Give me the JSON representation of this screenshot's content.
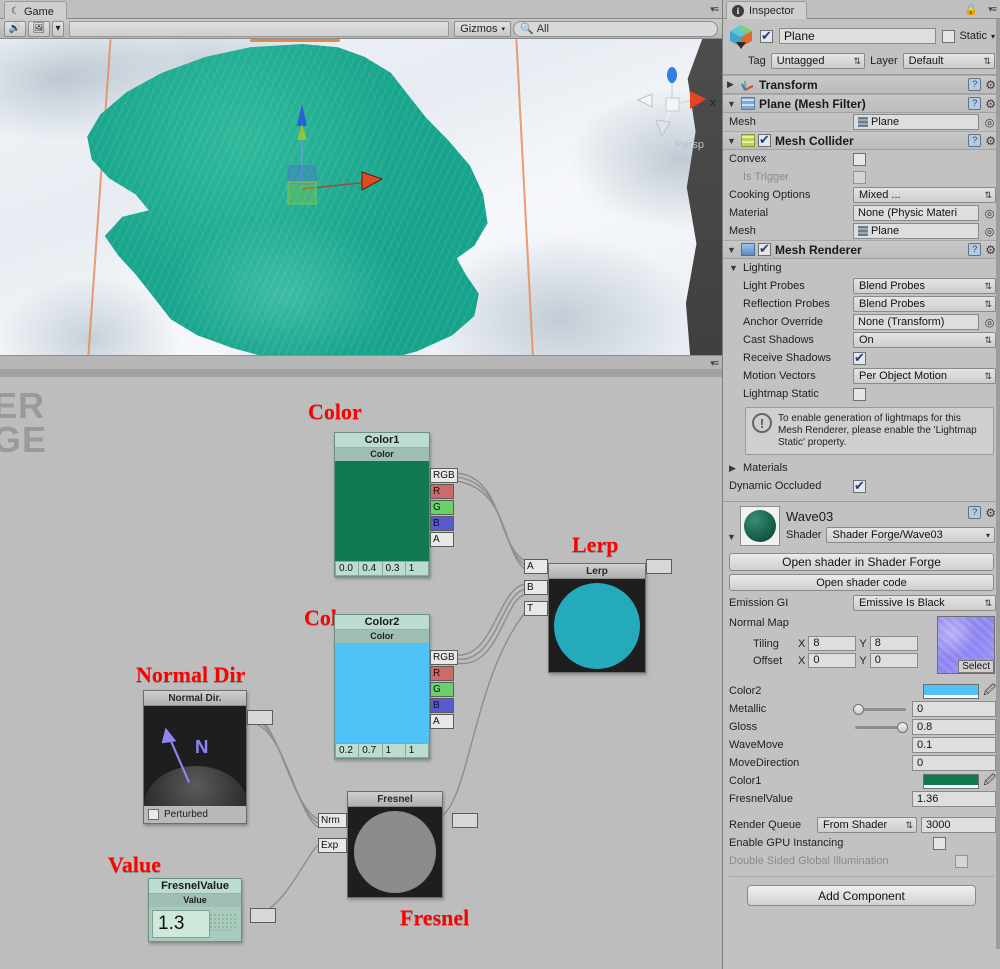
{
  "game_view": {
    "tab_label": "Game",
    "moon_icon": "moon-icon",
    "mute_icon": "mute-audio-icon",
    "stats_icon": "screenshot-icon",
    "gizmos_label": "Gizmos",
    "search_placeholder": "All",
    "search_value": "All",
    "persp_label": "Persp",
    "axis_x_label": "x",
    "watermark_line1": "DER",
    "watermark_line2": "RGE",
    "colors": {
      "water": "#16a88e",
      "terrain_light": "#eef2f7",
      "terrain_dark": "#454545",
      "grid_line": "#e88c5a"
    }
  },
  "graph": {
    "labels": {
      "color1": "Color",
      "color2": "Color",
      "lerp": "Lerp",
      "normal_dir": "Normal Dir",
      "value": "Value",
      "fresnel": "Fresnel"
    },
    "nodes": {
      "color1": {
        "name": "Color1",
        "type": "Color",
        "swatch": "#117a52",
        "channels": [
          "0.0",
          "0.4",
          "0.3",
          "1"
        ],
        "ports": [
          "RGB",
          "R",
          "G",
          "B",
          "A"
        ]
      },
      "color2": {
        "name": "Color2",
        "type": "Color",
        "swatch": "#4fc3f7",
        "channels": [
          "0.2",
          "0.7",
          "1",
          "1"
        ],
        "ports": [
          "RGB",
          "R",
          "G",
          "B",
          "A"
        ]
      },
      "lerp": {
        "title": "Lerp",
        "inputs": [
          "A",
          "B",
          "T"
        ],
        "preview_color": "#25aabb"
      },
      "normal_dir": {
        "title": "Normal Dir.",
        "checkbox_label": "Perturbed",
        "glyph": "N",
        "checked": false
      },
      "fresnel_value": {
        "name": "FresnelValue",
        "type": "Value",
        "value": "1.3"
      },
      "fresnel": {
        "title": "Fresnel",
        "inputs": [
          "Nrm",
          "Exp"
        ],
        "preview_color": "#8c8c8c"
      }
    }
  },
  "inspector": {
    "tab_label": "Inspector",
    "object": {
      "name": "Plane",
      "enabled": true,
      "static_label": "Static",
      "static_checked": false,
      "tag_label": "Tag",
      "tag_value": "Untagged",
      "layer_label": "Layer",
      "layer_value": "Default"
    },
    "components": [
      {
        "title": "Transform",
        "icon": "transform-axes-icon",
        "expanded": false
      },
      {
        "title": "Plane (Mesh Filter)",
        "icon": "mesh-filter-icon",
        "expanded": true,
        "rows": [
          {
            "label": "Mesh",
            "value": "Plane",
            "type": "object"
          }
        ]
      },
      {
        "title": "Mesh Collider",
        "icon": "mesh-collider-icon",
        "expanded": true,
        "enabled": true,
        "rows": [
          {
            "label": "Convex",
            "type": "checkbox",
            "checked": false
          },
          {
            "label": "Is Trigger",
            "type": "checkbox",
            "checked": false,
            "disabled": true
          },
          {
            "label": "Cooking Options",
            "type": "dropdown",
            "value": "Mixed ..."
          },
          {
            "label": "Material",
            "type": "object",
            "value": "None (Physic Materi"
          },
          {
            "label": "Mesh",
            "type": "object",
            "value": "Plane"
          }
        ]
      },
      {
        "title": "Mesh Renderer",
        "icon": "mesh-renderer-icon",
        "expanded": true,
        "enabled": true,
        "group": "Lighting",
        "rows": [
          {
            "label": "Light Probes",
            "type": "dropdown",
            "value": "Blend Probes"
          },
          {
            "label": "Reflection Probes",
            "type": "dropdown",
            "value": "Blend Probes"
          },
          {
            "label": "Anchor Override",
            "type": "object",
            "value": "None (Transform)"
          },
          {
            "label": "Cast Shadows",
            "type": "dropdown",
            "value": "On"
          },
          {
            "label": "Receive Shadows",
            "type": "checkbox",
            "checked": true
          },
          {
            "label": "Motion Vectors",
            "type": "dropdown",
            "value": "Per Object Motion"
          },
          {
            "label": "Lightmap Static",
            "type": "checkbox",
            "checked": false
          }
        ],
        "helpbox": "To enable generation of lightmaps for this Mesh Renderer, please enable the 'Lightmap Static' property.",
        "materials_label": "Materials",
        "dynamic_occluded_label": "Dynamic Occluded",
        "dynamic_occluded_checked": true
      }
    ],
    "material": {
      "name": "Wave03",
      "shader_label": "Shader",
      "shader_value": "Shader Forge/Wave03",
      "open_in_forge": "Open shader in Shader Forge",
      "open_code": "Open shader code",
      "emission_gi_label": "Emission GI",
      "emission_gi_value": "Emissive Is Black",
      "normal_map_label": "Normal Map",
      "tiling_label": "Tiling",
      "offset_label": "Offset",
      "tiling_x": "8",
      "tiling_y": "8",
      "offset_x": "0",
      "offset_y": "0",
      "select_label": "Select",
      "properties": [
        {
          "label": "Color2",
          "type": "color",
          "value": "#4fc3f7"
        },
        {
          "label": "Metallic",
          "type": "slider",
          "value": "0",
          "pct": 0
        },
        {
          "label": "Gloss",
          "type": "slider",
          "value": "0.8",
          "pct": 80
        },
        {
          "label": "WaveMove",
          "type": "number",
          "value": "0.1"
        },
        {
          "label": "MoveDirection",
          "type": "number",
          "value": "0"
        },
        {
          "label": "Color1",
          "type": "color",
          "value": "#0e7b4f"
        },
        {
          "label": "FresnelValue",
          "type": "number",
          "value": "1.36"
        }
      ],
      "render_queue_label": "Render Queue",
      "render_queue_mode": "From Shader",
      "render_queue_value": "3000",
      "gpu_instancing_label": "Enable GPU Instancing",
      "gpu_instancing_checked": false,
      "double_sided_label": "Double Sided Global Illumination",
      "double_sided_checked": false
    },
    "add_component_label": "Add Component"
  }
}
